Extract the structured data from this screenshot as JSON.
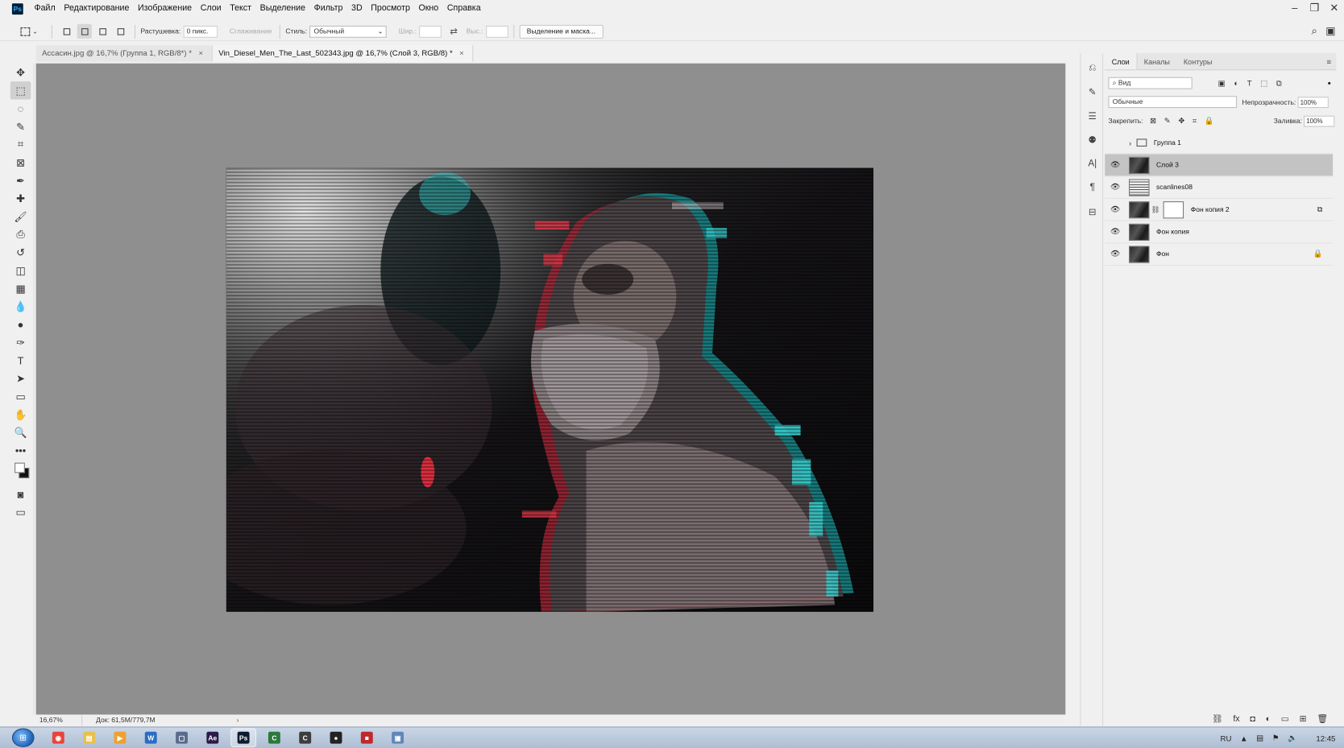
{
  "menu": {
    "items": [
      "Файл",
      "Редактирование",
      "Изображение",
      "Слои",
      "Текст",
      "Выделение",
      "Фильтр",
      "3D",
      "Просмотр",
      "Окно",
      "Справка"
    ],
    "app_logo": "Ps"
  },
  "window_controls": {
    "minimize": "–",
    "restore": "❐",
    "close": "✕"
  },
  "options": {
    "feather_label": "Растушевка:",
    "feather_value": "0 пикс.",
    "antialias_label": "Сглаживание",
    "style_label": "Стиль:",
    "style_value": "Обычный",
    "width_label": "Шир.:",
    "height_label": "Выс.:",
    "swap_icon": "⇄",
    "select_mask_button": "Выделение и маска..."
  },
  "doc_tabs": [
    {
      "label": "Ассасин.jpg @ 16,7% (Группа 1, RGB/8*) *",
      "close": "×"
    },
    {
      "label": "Vin_Diesel_Men_The_Last_502343.jpg @ 16,7% (Слой 3, RGB/8) *",
      "close": "×"
    }
  ],
  "tools": [
    "move-icon",
    "marquee-icon",
    "lasso-icon",
    "quick-select-icon",
    "crop-icon",
    "frame-icon",
    "eyedropper-icon",
    "healing-icon",
    "brush-icon",
    "stamp-icon",
    "history-brush-icon",
    "eraser-icon",
    "gradient-icon",
    "blur-icon",
    "dodge-icon",
    "pen-icon",
    "type-icon",
    "path-select-icon",
    "shape-icon",
    "hand-icon",
    "zoom-icon",
    "more-icon"
  ],
  "tool_glyphs": [
    "✥",
    "⬚",
    "◌",
    "✎",
    "⌗",
    "⊠",
    "✒",
    "✚",
    "🖌",
    "⎙",
    "↺",
    "◫",
    "▦",
    "💧",
    "●",
    "✑",
    "T",
    "➤",
    "▭",
    "✋",
    "🔍",
    "•••"
  ],
  "status": {
    "zoom": "16,67%",
    "doc": "Док: 61,5M/779,7M",
    "arrow": "›"
  },
  "layers_panel": {
    "tabs": [
      "Слои",
      "Каналы",
      "Контуры"
    ],
    "kind_filter": "Вид",
    "blend_mode": "Обычные",
    "opacity_label": "Непрозрачность:",
    "opacity_value": "100%",
    "lock_label": "Закрепить:",
    "fill_label": "Заливка:",
    "fill_value": "100%",
    "layers": [
      {
        "name": "Группа 1",
        "type": "group",
        "visible": false,
        "selected": false
      },
      {
        "name": "Слой 3",
        "type": "photo",
        "visible": true,
        "selected": true
      },
      {
        "name": "scanlines08",
        "type": "lines",
        "visible": true,
        "selected": false
      },
      {
        "name": "Фон копия 2",
        "type": "photo-mask",
        "visible": true,
        "selected": false,
        "flag": "⧉"
      },
      {
        "name": "Фон копия",
        "type": "photo",
        "visible": true,
        "selected": false
      },
      {
        "name": "Фон",
        "type": "photo",
        "visible": true,
        "selected": false,
        "flag": "🔒"
      }
    ],
    "footer_icons": [
      "link-icon",
      "fx-icon",
      "mask-icon",
      "adjustment-icon",
      "folder-icon",
      "new-layer-icon",
      "trash-icon"
    ],
    "footer_glyphs": [
      "⛓",
      "fx",
      "◘",
      "◐",
      "▭",
      "⊞",
      "🗑"
    ]
  },
  "taskbar": {
    "apps": [
      {
        "name": "chrome",
        "glyph": "◉",
        "color": "#e8453c"
      },
      {
        "name": "explorer",
        "glyph": "▤",
        "color": "#e8c14a"
      },
      {
        "name": "media",
        "glyph": "▶",
        "color": "#f0a030"
      },
      {
        "name": "word",
        "glyph": "W",
        "color": "#2b6cc4"
      },
      {
        "name": "app5",
        "glyph": "▢",
        "color": "#5a6b8c"
      },
      {
        "name": "after-effects",
        "glyph": "Ae",
        "color": "#2c1a4a"
      },
      {
        "name": "photoshop",
        "glyph": "Ps",
        "color": "#0d1b2e"
      },
      {
        "name": "app8",
        "glyph": "C",
        "color": "#2a7a3a"
      },
      {
        "name": "app9",
        "glyph": "C",
        "color": "#3d3d3d"
      },
      {
        "name": "app10",
        "glyph": "●",
        "color": "#222"
      },
      {
        "name": "app11",
        "glyph": "■",
        "color": "#c0282c"
      },
      {
        "name": "app12",
        "glyph": "▣",
        "color": "#5f87b8"
      }
    ],
    "active_index": 6,
    "lang": "RU",
    "clock": "12:45"
  }
}
